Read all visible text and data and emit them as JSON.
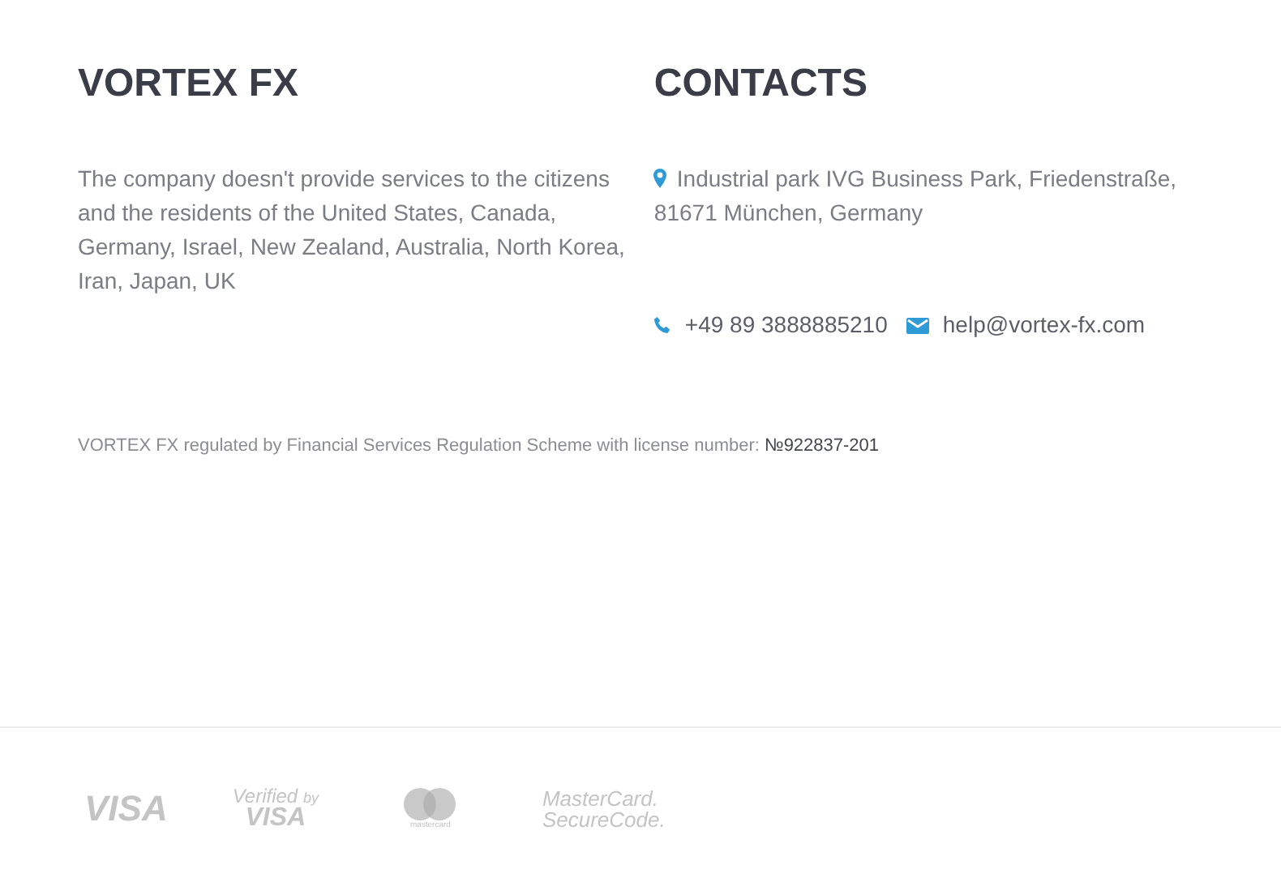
{
  "company": {
    "title": "VORTEX FX",
    "notice": "The company doesn't provide services to the citizens and the residents of the United States, Canada, Germany, Israel, New Zealand, Australia, North Korea, Iran, Japan, UK"
  },
  "contacts": {
    "title": "CONTACTS",
    "address": "Industrial park IVG Business Park, Friedenstraße, 81671 München, Germany",
    "phone": "+49 89 3888885210",
    "email": "help@vortex-fx.com"
  },
  "regulation": {
    "text": "VORTEX FX regulated by Financial Services Regulation Scheme with license number:",
    "license_number": "№922837-201"
  },
  "payment_logos": [
    {
      "kind": "visa",
      "lines": [
        "VISA"
      ]
    },
    {
      "kind": "verified",
      "lines": [
        "Verified",
        "by",
        "VISA"
      ]
    },
    {
      "kind": "mastercard",
      "lines": [
        "mastercard"
      ]
    },
    {
      "kind": "securecode",
      "lines": [
        "MasterCard.",
        "SecureCode."
      ]
    }
  ]
}
